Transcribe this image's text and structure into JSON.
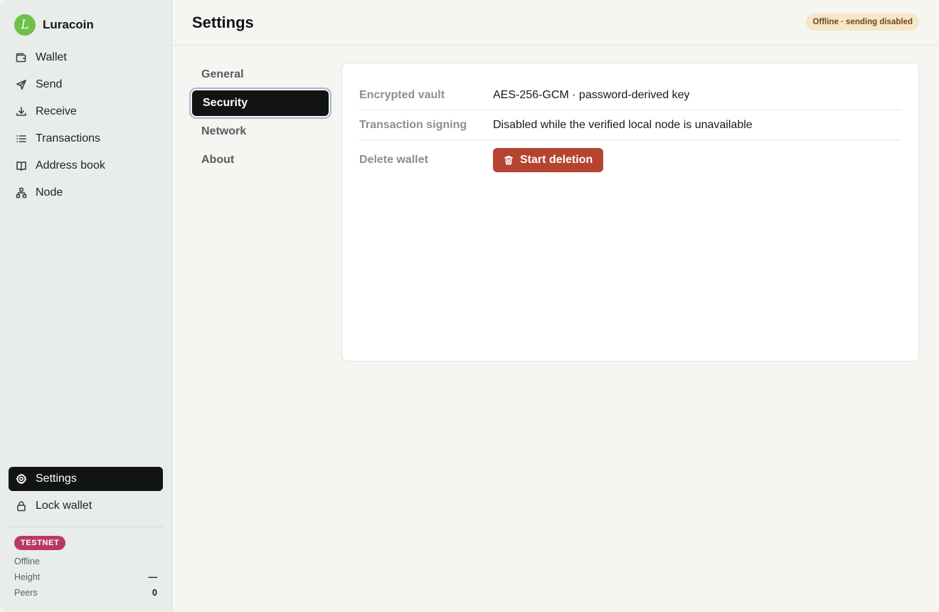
{
  "app": {
    "name": "Luracoin",
    "logo_glyph": "L",
    "brand_color": "#6fbf4b"
  },
  "sidebar": {
    "items": [
      {
        "label": "Wallet",
        "icon": "wallet-icon"
      },
      {
        "label": "Send",
        "icon": "send-icon"
      },
      {
        "label": "Receive",
        "icon": "download-icon"
      },
      {
        "label": "Transactions",
        "icon": "list-icon"
      },
      {
        "label": "Address book",
        "icon": "book-icon"
      },
      {
        "label": "Node",
        "icon": "network-icon"
      }
    ],
    "bottom_items": [
      {
        "label": "Settings",
        "icon": "gear-icon",
        "active": true
      },
      {
        "label": "Lock wallet",
        "icon": "lock-icon"
      }
    ],
    "status": {
      "network_badge": "TESTNET",
      "connection": "Offline",
      "height_label": "Height",
      "height_value": "—",
      "peers_label": "Peers",
      "peers_value": "0"
    }
  },
  "header": {
    "title": "Settings",
    "status_pill": "Offline · sending disabled"
  },
  "settings_nav": {
    "items": [
      "General",
      "Security",
      "Network",
      "About"
    ],
    "selected": "Security"
  },
  "security": {
    "rows": [
      {
        "label": "Encrypted vault",
        "value": "AES-256-GCM · password-derived key"
      },
      {
        "label": "Transaction signing",
        "value": "Disabled while the verified local node is unavailable"
      },
      {
        "label": "Delete wallet",
        "button": "Start deletion"
      }
    ]
  },
  "colors": {
    "accent_dark": "#121414",
    "danger": "#b5432f",
    "testnet_badge": "#b83a63",
    "offline_pill_bg": "#f7e6c9"
  }
}
